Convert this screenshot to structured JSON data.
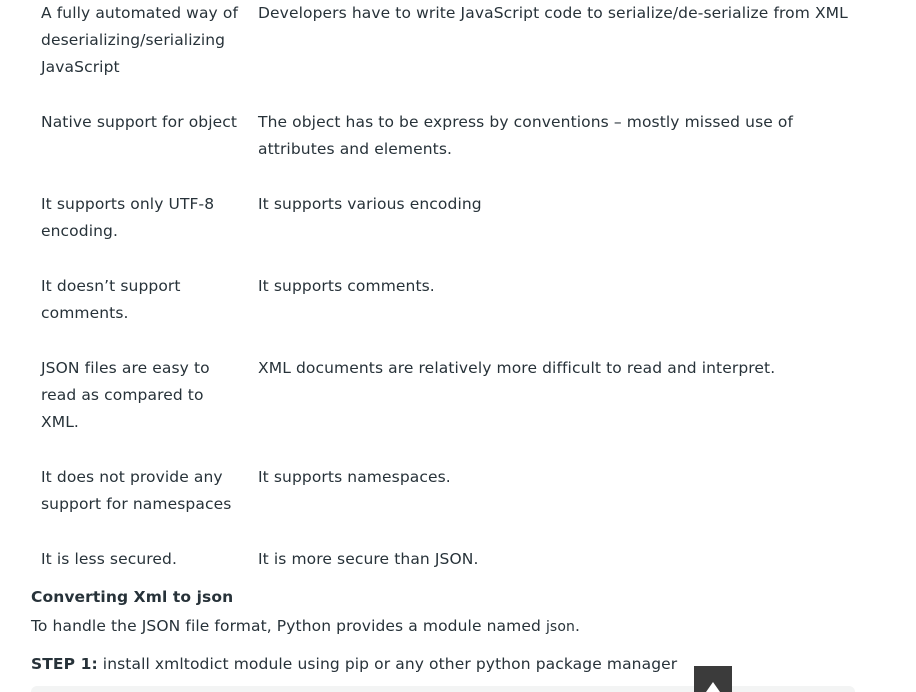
{
  "table": {
    "rows": [
      {
        "json": "A fully automated way of deserializing/serializing JavaScript",
        "xml": "Developers have to write JavaScript code to serialize/de-serialize from XML"
      },
      {
        "json": "Native support for object",
        "xml": "The object has to be express by conventions – mostly missed use of attributes and elements."
      },
      {
        "json": "It supports only UTF-8 encoding.",
        "xml": "It supports various encoding"
      },
      {
        "json": "It doesn’t support comments.",
        "xml": "It supports comments."
      },
      {
        "json": "JSON files are easy to read as compared to XML.",
        "xml": "XML documents are relatively more difficult to read and interpret."
      },
      {
        "json": "It does not provide any support for namespaces",
        "xml": "It supports namespaces."
      },
      {
        "json": "It is less secured.",
        "xml": "It is more secure than JSON."
      }
    ]
  },
  "section": {
    "heading": "Converting Xml to json",
    "intro_text": "To handle the JSON file format, Python provides a module named ",
    "intro_code": "json",
    "intro_end": ".",
    "step_label": "STEP 1:",
    "step_text": " install xmltodict module using pip or any other python package manager"
  },
  "icons": {
    "scroll_top": "arrow-up-icon"
  }
}
